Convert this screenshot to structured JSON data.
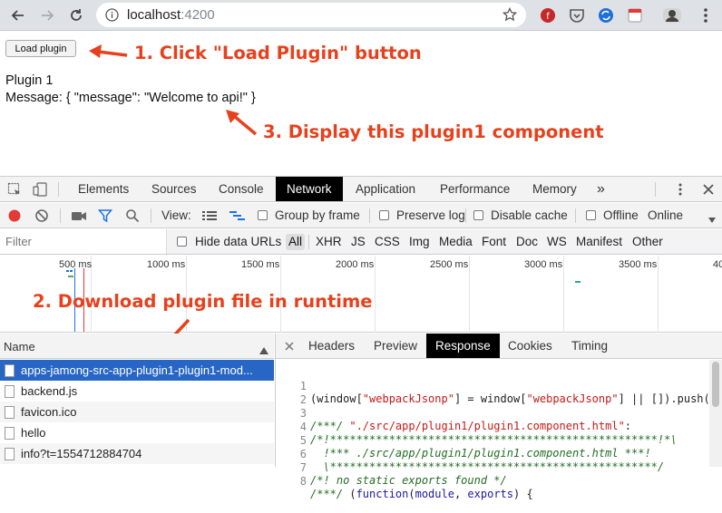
{
  "browser": {
    "url_host": "localhost",
    "url_port": ":4200"
  },
  "page": {
    "load_button": "Load plugin",
    "plugin_title": "Plugin 1",
    "plugin_message": "Message: { \"message\": \"Welcome to api!\" }"
  },
  "annotations": {
    "step1": "1. Click \"Load Plugin\" button",
    "step2": "2. Download plugin file in runtime",
    "step3": "3. Display this plugin1 component",
    "color": "#e8401c"
  },
  "devtools": {
    "tabs": [
      "Elements",
      "Sources",
      "Console",
      "Network",
      "Application",
      "Performance",
      "Memory"
    ],
    "active_tab": "Network",
    "more": "»",
    "toolbar": {
      "view_label": "View:",
      "group_by_frame": "Group by frame",
      "preserve_log": "Preserve log",
      "disable_cache": "Disable cache",
      "offline": "Offline",
      "online": "Online"
    },
    "filter": {
      "placeholder": "Filter",
      "hide_data_urls": "Hide data URLs",
      "types": [
        "All",
        "XHR",
        "JS",
        "CSS",
        "Img",
        "Media",
        "Font",
        "Doc",
        "WS",
        "Manifest",
        "Other"
      ]
    },
    "timeline": {
      "ticks": [
        "500 ms",
        "1000 ms",
        "1500 ms",
        "2000 ms",
        "2500 ms",
        "3000 ms",
        "3500 ms",
        "40"
      ]
    },
    "requests": {
      "header": "Name",
      "items": [
        "apps-jamong-src-app-plugin1-plugin1-mod...",
        "backend.js",
        "favicon.ico",
        "hello",
        "info?t=1554712884704"
      ]
    },
    "detail": {
      "tabs": [
        "Headers",
        "Preview",
        "Response",
        "Cookies",
        "Timing"
      ],
      "active_tab": "Response",
      "line_numbers": [
        "1",
        "2",
        "3",
        "4",
        "5",
        "6",
        "7",
        "8"
      ]
    }
  }
}
